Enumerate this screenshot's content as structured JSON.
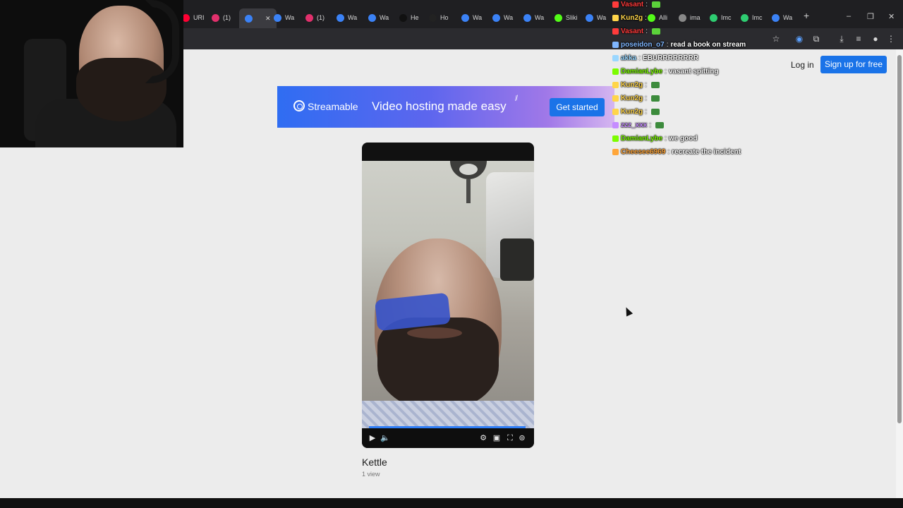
{
  "browser": {
    "tabs": [
      {
        "label": "URI",
        "icon": "youtube-icon",
        "color": "#ff0033"
      },
      {
        "label": "(1)",
        "icon": "instagram-icon",
        "color": "#e1306c"
      },
      {
        "label": "",
        "icon": "streamable-icon",
        "color": "#3b82f6",
        "active": true
      },
      {
        "label": "Wa",
        "icon": "streamable-icon",
        "color": "#3b82f6"
      },
      {
        "label": "(1)",
        "icon": "instagram-icon",
        "color": "#e1306c"
      },
      {
        "label": "Wa",
        "icon": "streamable-icon",
        "color": "#3b82f6"
      },
      {
        "label": "Wa",
        "icon": "streamable-icon",
        "color": "#3b82f6"
      },
      {
        "label": "He",
        "icon": "tiktok-icon",
        "color": "#111111"
      },
      {
        "label": "Ho",
        "icon": "x-icon",
        "color": "#222222"
      },
      {
        "label": "Wa",
        "icon": "streamable-icon",
        "color": "#3b82f6"
      },
      {
        "label": "Wa",
        "icon": "streamable-icon",
        "color": "#3b82f6"
      },
      {
        "label": "Wa",
        "icon": "streamable-icon",
        "color": "#3b82f6"
      },
      {
        "label": "Sliki",
        "icon": "kick-icon",
        "color": "#53fc18"
      },
      {
        "label": "Wa",
        "icon": "streamable-icon",
        "color": "#3b82f6"
      },
      {
        "label": "Alli",
        "icon": "kick-icon",
        "color": "#53fc18"
      },
      {
        "label": "ima",
        "icon": "globe-icon",
        "color": "#888888"
      },
      {
        "label": "Imc",
        "icon": "image-icon",
        "color": "#2ecc71"
      },
      {
        "label": "Imc",
        "icon": "image-icon",
        "color": "#2ecc71"
      },
      {
        "label": "Wa",
        "icon": "streamable-icon",
        "color": "#3b82f6"
      }
    ],
    "new_tab_glyph": "+",
    "window_controls": {
      "minimize": "–",
      "restore": "❐",
      "close": "✕"
    },
    "toolbar_icons": [
      "star-icon",
      "media-icon",
      "extensions-icon",
      "download-icon",
      "reading-list-icon",
      "profile-icon",
      "menu-icon"
    ]
  },
  "site": {
    "login_label": "Log in",
    "signup_label": "Sign up for free",
    "banner": {
      "brand": "Streamable",
      "tagline": "Video hosting made easy",
      "cta": "Get started"
    },
    "video": {
      "title": "Kettle",
      "views": "1 view",
      "progress": 1.0
    }
  },
  "chat": [
    {
      "user": "Vasant",
      "message": "",
      "user_color": "#ff3b3b",
      "emote": "#5bd23a"
    },
    {
      "user": "Kun2g",
      "message": "",
      "user_color": "#ffd54a",
      "emote": ""
    },
    {
      "user": "Vasant",
      "message": "",
      "user_color": "#ff3b3b",
      "emote": "#5bd23a"
    },
    {
      "user": "poseidon_o7",
      "message": "read a book on stream",
      "user_color": "#7fb6ff",
      "emote": ""
    },
    {
      "user": "akka",
      "message": "EBURRRRRRRR",
      "user_color": "#9ad7ff",
      "emote": ""
    },
    {
      "user": "DamianLybe",
      "message": "vasant spitting",
      "user_color": "#7CFC00",
      "emote": ""
    },
    {
      "user": "Kun2g",
      "message": "",
      "user_color": "#ffd54a",
      "emote": "#3c8b3c"
    },
    {
      "user": "Kun2g",
      "message": "",
      "user_color": "#ffd54a",
      "emote": "#3c8b3c"
    },
    {
      "user": "Kun2g",
      "message": "",
      "user_color": "#ffd54a",
      "emote": "#3c8b3c"
    },
    {
      "user": "zzz_xxx",
      "message": "",
      "user_color": "#c58cff",
      "emote": "#3c8b3c"
    },
    {
      "user": "DamianLybe",
      "message": "we good",
      "user_color": "#7CFC00",
      "emote": ""
    },
    {
      "user": "Cheesee6969",
      "message": "recreate the incident",
      "user_color": "#ffa63a",
      "emote": ""
    }
  ]
}
